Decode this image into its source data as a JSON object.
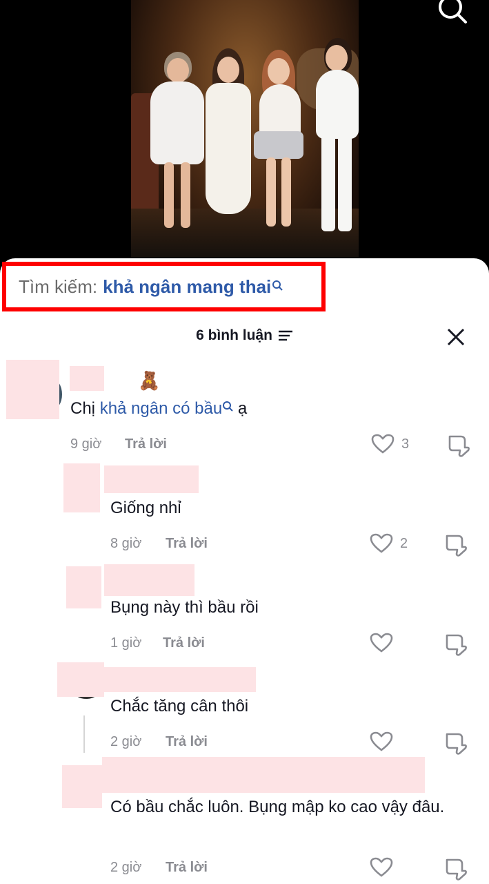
{
  "search": {
    "prefix": "Tìm kiếm:",
    "term": "khả ngân mang thai"
  },
  "header": {
    "comment_count": "6 bình luận"
  },
  "comments": [
    {
      "emoji": "🧸",
      "text_before": "Chị ",
      "text_link": "khả ngân có bầu",
      "text_after": " ạ",
      "time": "9 giờ",
      "reply_label": "Trả lời",
      "likes": "3"
    },
    {
      "text": "Giống nhỉ",
      "time": "8 giờ",
      "reply_label": "Trả lời",
      "likes": "2"
    },
    {
      "text": "Bụng này thì bầu rồi",
      "time": "1 giờ",
      "reply_label": "Trả lời",
      "likes": ""
    },
    {
      "text": "Chắc tăng cân thôi",
      "time": "2 giờ",
      "reply_label": "Trả lời",
      "likes": ""
    },
    {
      "text": "Có bầu chắc luôn. Bụng mập ko cao vậy đâu.",
      "time": "2 giờ",
      "reply_label": "Trả lời",
      "likes": ""
    }
  ],
  "colors": {
    "highlight_box": "#fe0000",
    "link_blue": "#2e5aa8",
    "redaction": "#fde3e5"
  }
}
